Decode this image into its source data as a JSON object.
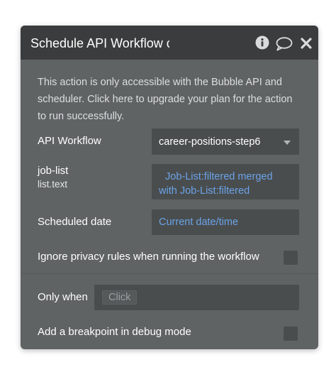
{
  "header": {
    "title": "Schedule API Workflow c",
    "info_icon": "info-icon",
    "comment_icon": "comment-icon",
    "close_icon": "close-icon"
  },
  "notice": {
    "text": "This action is only accessible with the Bubble API and scheduler. Click here to upgrade your plan for the action to run successfully."
  },
  "fields": {
    "api_workflow": {
      "label": "API Workflow",
      "value": "career-positions-step6"
    },
    "job_list": {
      "label": "job-list",
      "type": "list.text",
      "value": "Job-List:filtered merged with Job-List:filtered"
    },
    "scheduled_date": {
      "label": "Scheduled date",
      "value": "Current date/time"
    },
    "ignore_privacy": {
      "label": "Ignore privacy rules when running the workflow",
      "checked": false
    },
    "only_when": {
      "label": "Only when",
      "placeholder": "Click"
    },
    "breakpoint": {
      "label": "Add a breakpoint in debug mode",
      "checked": false
    }
  },
  "colors": {
    "panel_bg": "#5f6364",
    "header_bg": "#3a3c3d",
    "field_bg": "#4a4d4e",
    "expression": "#6aa3e8"
  }
}
